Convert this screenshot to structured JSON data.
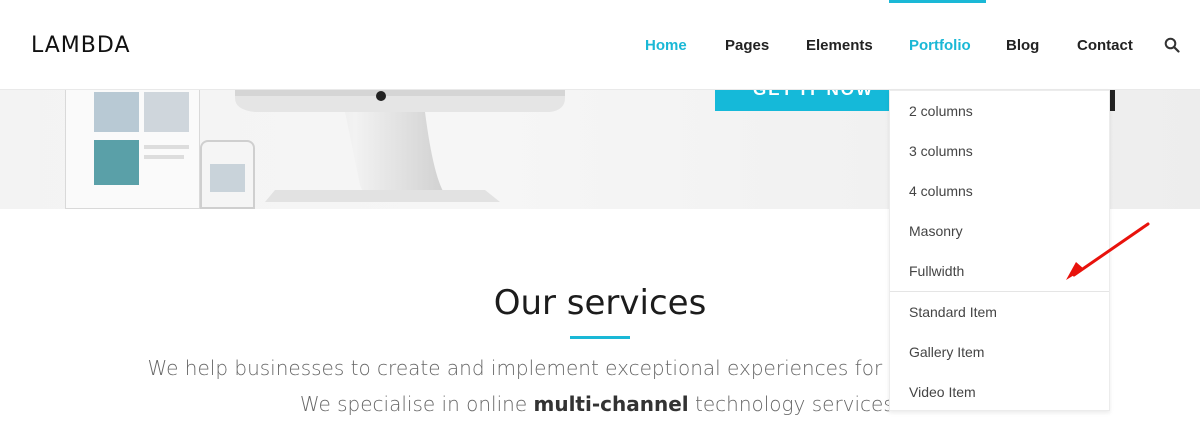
{
  "header": {
    "logo": "LAMBDA",
    "nav": [
      {
        "label": "Home",
        "active": true
      },
      {
        "label": "Pages",
        "active": false
      },
      {
        "label": "Elements",
        "active": false
      },
      {
        "label": "Portfolio",
        "active": true
      },
      {
        "label": "Blog",
        "active": false
      },
      {
        "label": "Contact",
        "active": false
      }
    ],
    "search_icon": "search-icon"
  },
  "hero": {
    "button_label": "GET IT NOW"
  },
  "dropdown": {
    "items": [
      "2 columns",
      "3 columns",
      "4 columns",
      "Masonry",
      "Fullwidth"
    ],
    "items2": [
      "Standard Item",
      "Gallery Item",
      "Video Item"
    ]
  },
  "services": {
    "title": "Our services",
    "line1": "We help businesses to create and implement exceptional experiences for their customers.",
    "line2_pre": "We specialise in online ",
    "line2_bold": "multi-channel",
    "line2_post": " technology services."
  },
  "colors": {
    "accent": "#1ab8d6",
    "annotation_arrow": "#e8120c"
  }
}
